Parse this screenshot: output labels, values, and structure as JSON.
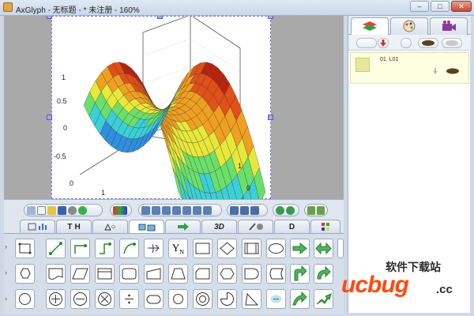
{
  "window": {
    "title": "AxGlyph - 无标题 - * 未注册 - 160%",
    "min_glyph": "–",
    "max_glyph": "□",
    "close_glyph": "✕"
  },
  "plot": {
    "z_ticks": [
      "1",
      "0.5",
      "0",
      "-0.5"
    ],
    "y_ticks": [
      "1",
      "0"
    ],
    "x_ticks": [
      "1",
      "0"
    ],
    "colors": [
      "#2a2ad6",
      "#2e8fe0",
      "#3ad0d6",
      "#6ae06a",
      "#e8e83a",
      "#f0a020",
      "#e05018",
      "#b82410"
    ]
  },
  "panel": {
    "tabs": [
      "",
      "T",
      "",
      "",
      "",
      "3D",
      "",
      "",
      ""
    ],
    "tab_extra": [
      "",
      "H",
      "△○",
      "",
      "",
      "",
      "",
      "D",
      ""
    ],
    "tool_yn": "Y",
    "tool_yn_sub": "N"
  },
  "layers": {
    "row1_label": "01. L01"
  },
  "watermark": {
    "top": "软件下载站",
    "main": "ucbug",
    "suffix": ".cc"
  }
}
